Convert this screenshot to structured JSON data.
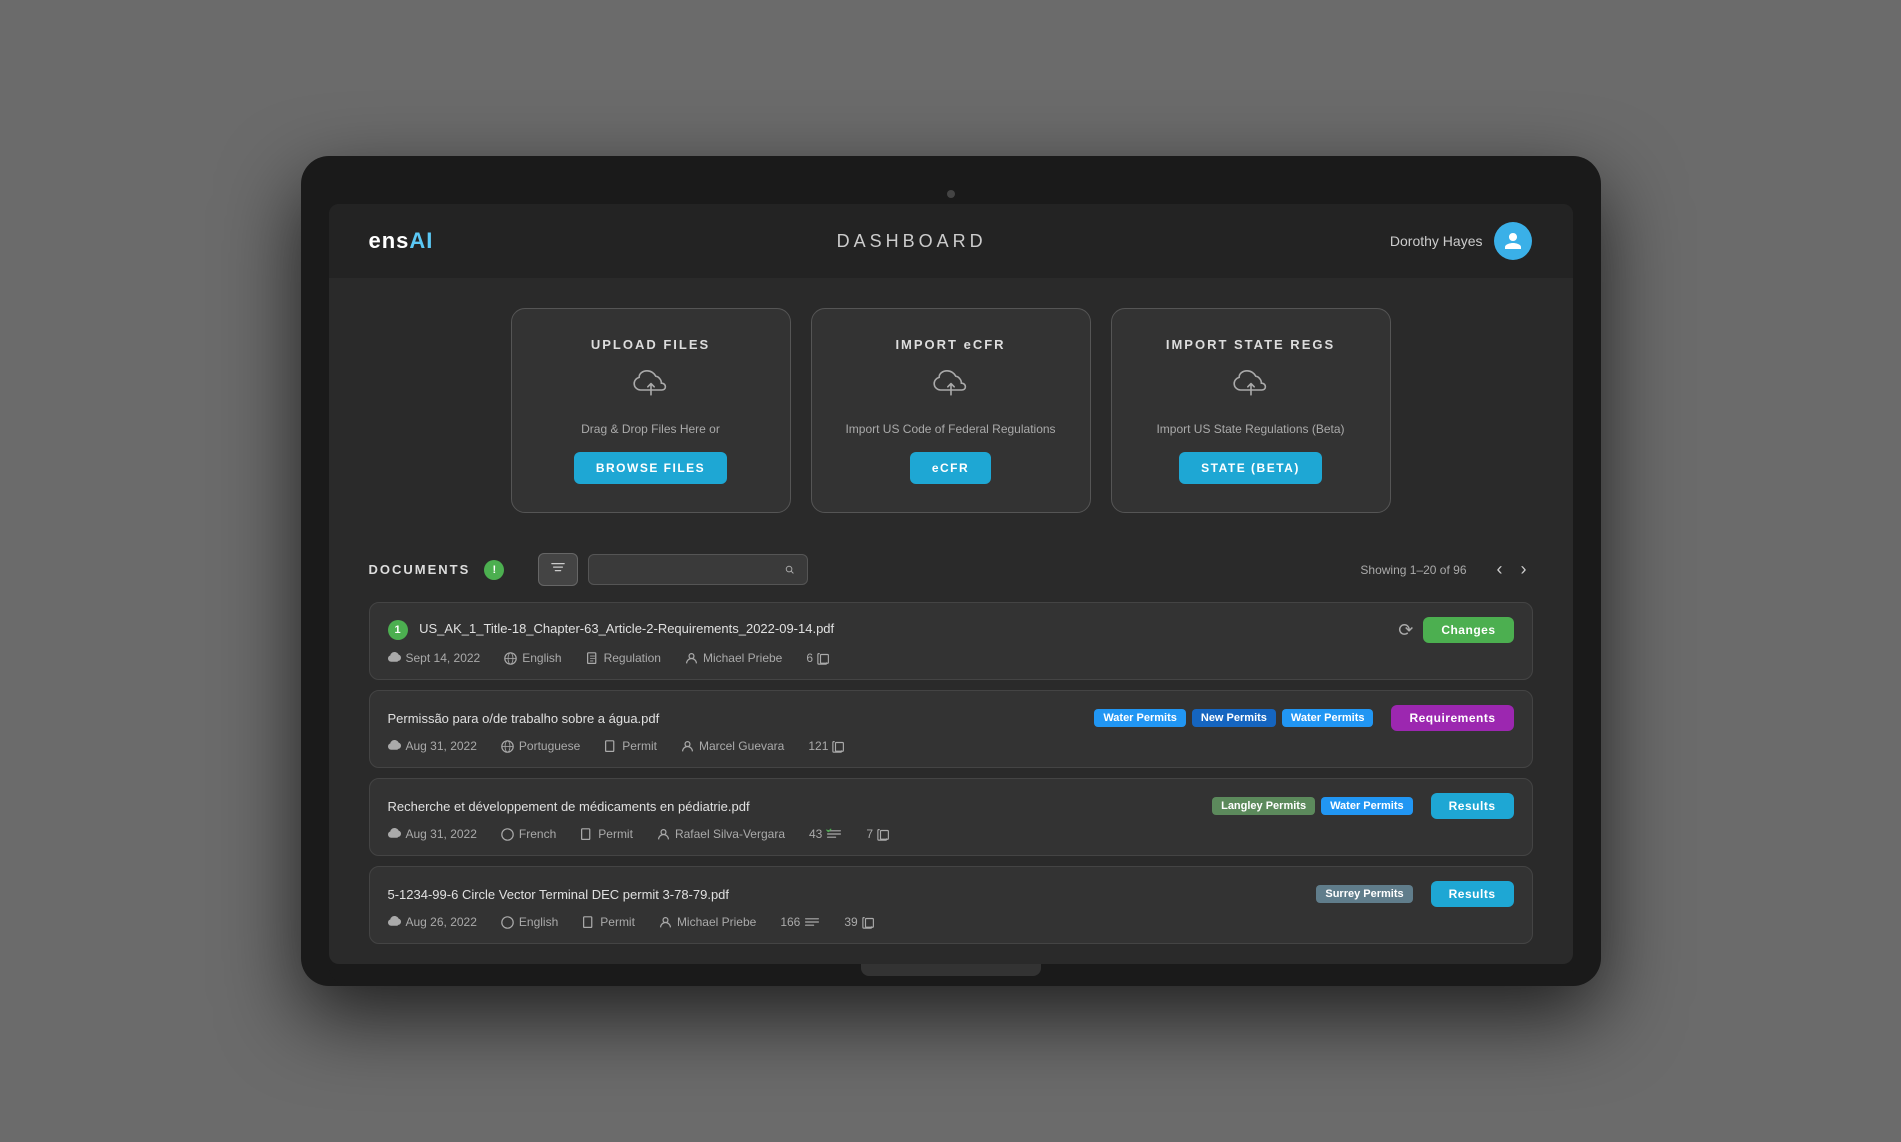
{
  "header": {
    "logo_text": "ens",
    "logo_accent": "AI",
    "logo_dots": "...",
    "title": "DASHBOARD",
    "user_name": "Dorothy Hayes",
    "user_icon": "👤"
  },
  "cards": [
    {
      "id": "upload",
      "title": "UPLOAD FILES",
      "description": "Drag & Drop Files Here or",
      "button_label": "BROWSE FILES"
    },
    {
      "id": "ecfr",
      "title": "IMPORT eCFR",
      "description": "Import US Code of Federal Regulations",
      "button_label": "eCFR"
    },
    {
      "id": "state",
      "title": "IMPORT STATE REGS",
      "description": "Import US State Regulations (Beta)",
      "button_label": "STATE (BETA)"
    }
  ],
  "documents": {
    "section_title": "DOCUMENTS",
    "pagination_text": "Showing 1–20 of 96",
    "search_placeholder": "",
    "rows": [
      {
        "id": 1,
        "version": "1",
        "name": "US_AK_1_Title-18_Chapter-63_Article-2-Requirements_2022-09-14.pdf",
        "date": "Sept 14, 2022",
        "language": "English",
        "type": "Regulation",
        "author": "Michael Priebe",
        "count": "6",
        "tags": [],
        "action": "Changes",
        "action_type": "changes",
        "has_history": true
      },
      {
        "id": 2,
        "version": null,
        "name": "Permissão para o/de trabalho sobre a água.pdf",
        "date": "Aug 31, 2022",
        "language": "Portuguese",
        "type": "Permit",
        "author": "Marcel Guevara",
        "count": "121",
        "tags": [
          "Water Permits",
          "New Permits",
          "Water Permits"
        ],
        "tag_types": [
          "water",
          "new-permits",
          "water"
        ],
        "action": "Requirements",
        "action_type": "requirements",
        "has_history": false
      },
      {
        "id": 3,
        "version": null,
        "name": "Recherche et développement de médicaments en pédiatrie.pdf",
        "date": "Aug 31, 2022",
        "language": "French",
        "type": "Permit",
        "author": "Rafael Silva-Vergara",
        "count_check": "43",
        "count": "7",
        "tags": [
          "Langley Permits",
          "Water Permits"
        ],
        "tag_types": [
          "langley",
          "water"
        ],
        "action": "Results",
        "action_type": "results",
        "has_history": false
      },
      {
        "id": 4,
        "version": null,
        "name": "5-1234-99-6 Circle Vector Terminal DEC permit 3-78-79.pdf",
        "date": "Aug 26, 2022",
        "language": "English",
        "type": "Permit",
        "author": "Michael Priebe",
        "count_check": "166",
        "count": "39",
        "tags": [
          "Surrey Permits"
        ],
        "tag_types": [
          "surrey"
        ],
        "action": "Results",
        "action_type": "results",
        "has_history": false
      }
    ]
  }
}
